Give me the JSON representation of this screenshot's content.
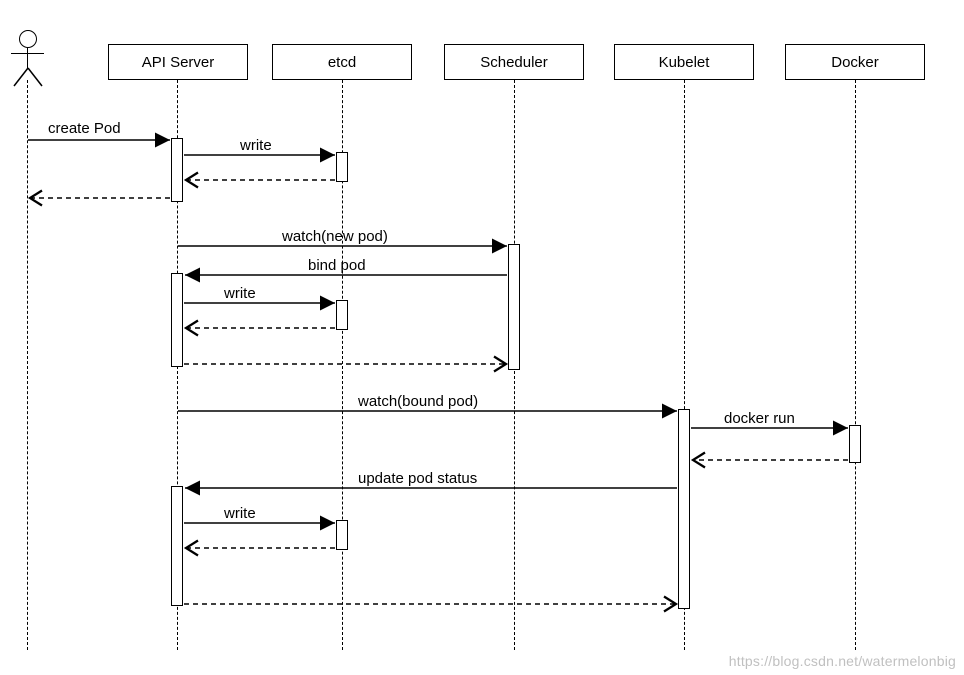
{
  "participants": {
    "api": {
      "label": "API Server"
    },
    "etcd": {
      "label": "etcd"
    },
    "scheduler": {
      "label": "Scheduler"
    },
    "kubelet": {
      "label": "Kubelet"
    },
    "docker": {
      "label": "Docker"
    }
  },
  "messages": {
    "create_pod": {
      "label": "create Pod"
    },
    "write1": {
      "label": "write"
    },
    "watch_new": {
      "label": "watch(new pod)"
    },
    "bind_pod": {
      "label": "bind pod"
    },
    "write2": {
      "label": "write"
    },
    "watch_bound": {
      "label": "watch(bound pod)"
    },
    "docker_run": {
      "label": "docker run"
    },
    "update_status": {
      "label": "update pod status"
    },
    "write3": {
      "label": "write"
    }
  },
  "watermark": "https://blog.csdn.net/watermelonbig"
}
